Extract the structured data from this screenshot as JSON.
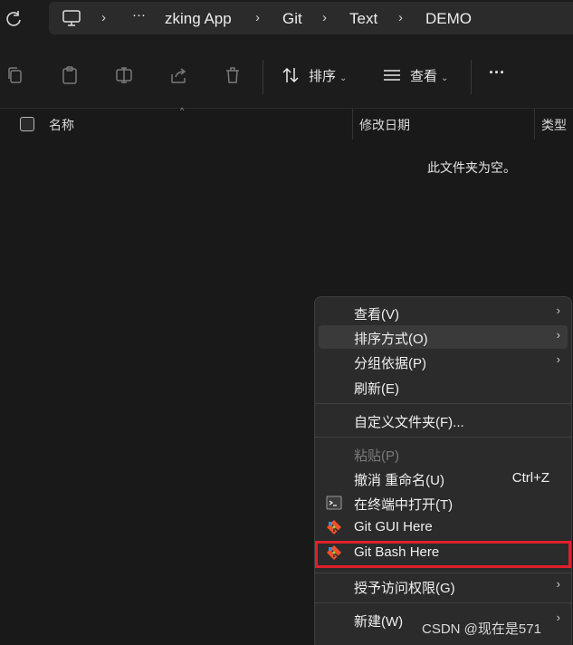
{
  "address": {
    "crumbs": [
      "zking App",
      "Git",
      "Text",
      "DEMO"
    ],
    "more": "···"
  },
  "toolbar": {
    "sort_label": "排序",
    "view_label": "查看",
    "more_label": "···"
  },
  "columns": {
    "name": "名称",
    "modified": "修改日期",
    "type": "类型"
  },
  "empty_message": "此文件夹为空。",
  "context_menu": {
    "items": [
      {
        "label": "查看(V)",
        "submenu": true
      },
      {
        "label": "排序方式(O)",
        "submenu": true,
        "hovered": true
      },
      {
        "label": "分组依据(P)",
        "submenu": true
      },
      {
        "label": "刷新(E)"
      },
      {
        "label": "自定义文件夹(F)..."
      },
      {
        "label": "粘贴(P)",
        "disabled": true
      },
      {
        "label": "撤消 重命名(U)",
        "shortcut": "Ctrl+Z"
      },
      {
        "label": "在终端中打开(T)",
        "icon": "terminal-icon"
      },
      {
        "label": "Git GUI Here",
        "icon": "git-icon"
      },
      {
        "label": "Git Bash Here",
        "icon": "git-icon",
        "highlighted": true
      },
      {
        "label": "授予访问权限(G)",
        "submenu": true
      },
      {
        "label": "新建(W)",
        "submenu": true
      }
    ],
    "submenu_arrow": "›"
  },
  "watermark": "CSDN @现在是571",
  "colors": {
    "background": "#191919",
    "menu_bg": "#2b2b2b",
    "highlight_border": "#e0202a"
  }
}
